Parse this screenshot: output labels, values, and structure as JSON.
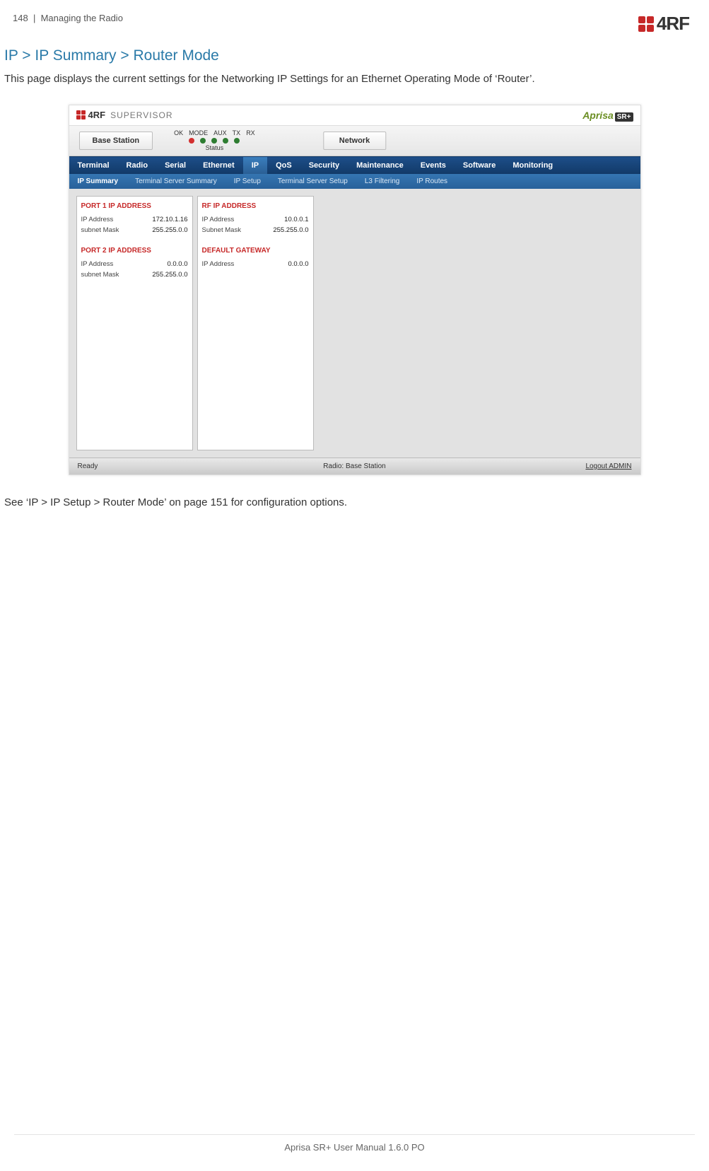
{
  "page": {
    "number": "148",
    "section_sep": "|",
    "section": "Managing the Radio",
    "footer": "Aprisa SR+ User Manual 1.6.0 PO"
  },
  "logo": {
    "text": "4RF"
  },
  "breadcrumb": "IP > IP Summary > Router Mode",
  "description": "This page displays the current settings for the Networking IP Settings for an Ethernet Operating Mode of ‘Router’.",
  "post_text": "See ‘IP > IP Setup > Router Mode’ on page 151 for configuration options.",
  "shot": {
    "brand": "4RF",
    "brand_product": "SUPERVISOR",
    "aprisa": "Aprisa",
    "aprisa_badge": "SR+",
    "graybar": {
      "base_station": "Base Station",
      "network": "Network",
      "status_labels": [
        "OK",
        "MODE",
        "AUX",
        "TX",
        "RX"
      ],
      "status_text": "Status",
      "led_colors": [
        "red",
        "grn",
        "grn",
        "grn",
        "grn"
      ]
    },
    "menubar": {
      "items": [
        "Terminal",
        "Radio",
        "Serial",
        "Ethernet",
        "IP",
        "QoS",
        "Security",
        "Maintenance",
        "Events",
        "Software",
        "Monitoring"
      ],
      "active_index": 4
    },
    "submenubar": {
      "items": [
        "IP Summary",
        "Terminal Server Summary",
        "IP Setup",
        "Terminal Server Setup",
        "L3 Filtering",
        "IP Routes"
      ],
      "active_index": 0
    },
    "panels": [
      {
        "sections": [
          {
            "title": "PORT 1 IP ADDRESS",
            "rows": [
              {
                "label": "IP Address",
                "value": "172.10.1.16"
              },
              {
                "label": "subnet Mask",
                "value": "255.255.0.0"
              }
            ]
          },
          {
            "title": "PORT 2 IP ADDRESS",
            "rows": [
              {
                "label": "IP Address",
                "value": "0.0.0.0"
              },
              {
                "label": "subnet Mask",
                "value": "255.255.0.0"
              }
            ]
          }
        ]
      },
      {
        "sections": [
          {
            "title": "RF IP ADDRESS",
            "rows": [
              {
                "label": "IP Address",
                "value": "10.0.0.1"
              },
              {
                "label": "Subnet Mask",
                "value": "255.255.0.0"
              }
            ]
          },
          {
            "title": "DEFAULT GATEWAY",
            "rows": [
              {
                "label": "IP Address",
                "value": "0.0.0.0"
              }
            ]
          }
        ]
      }
    ],
    "footerbar": {
      "ready": "Ready",
      "radio": "Radio: Base Station",
      "logout": "Logout ADMIN"
    }
  }
}
